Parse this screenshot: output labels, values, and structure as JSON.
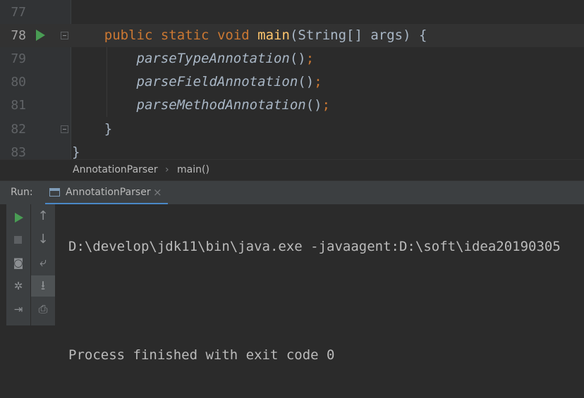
{
  "editor": {
    "lines": [
      {
        "num": "77"
      },
      {
        "num": "78",
        "current": true
      },
      {
        "num": "79"
      },
      {
        "num": "80"
      },
      {
        "num": "81"
      },
      {
        "num": "82"
      },
      {
        "num": "83"
      }
    ],
    "code": {
      "kw_public": "public",
      "kw_static": "static",
      "kw_void": "void",
      "method_main": "main",
      "main_params": "(String[] args) {",
      "call_type": "parseTypeAnnotation",
      "call_field": "parseFieldAnnotation",
      "call_method": "parseMethodAnnotation",
      "parens": "()",
      "semicolon": ";",
      "close_brace": "}",
      "class_close_brace": "}"
    }
  },
  "breadcrumb": {
    "class_name": "AnnotationParser",
    "separator": "›",
    "method": "main()"
  },
  "run_panel": {
    "label": "Run:",
    "tab_label": "AnnotationParser",
    "tab_close": "×"
  },
  "console": {
    "lines": [
      "D:\\develop\\jdk11\\bin\\java.exe -javaagent:D:\\soft\\idea20190305",
      "",
      "Process finished with exit code 0"
    ]
  },
  "toolbar_icons": {
    "rerun": "run-icon",
    "stop": "stop-icon",
    "camera": "camera-icon",
    "debug": "bug-icon",
    "exit": "exit-icon",
    "up": "↑",
    "down": "↓",
    "wrap": "⤶",
    "scroll_end": "⭳",
    "print": "print-icon"
  },
  "colors": {
    "keyword": "#cc7832",
    "method_decl": "#ffc66d",
    "text": "#a9b7c6",
    "run_green": "#499c54",
    "tab_underline": "#4a88c7"
  }
}
